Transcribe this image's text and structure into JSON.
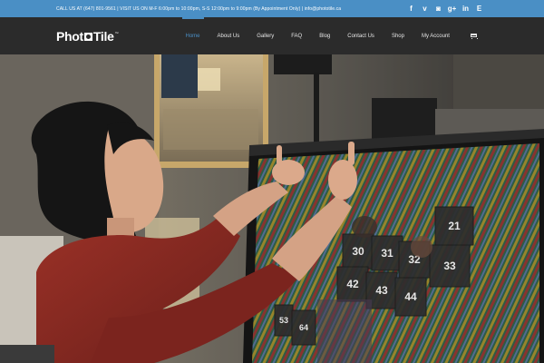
{
  "topbar": {
    "contact": "CALL US AT (647) 801-9561 | VISIT US ON M-F 6:00pm to 10:00pm, S-S 12:00pm to 9:00pm (By Appointment Only) | info@phototile.ca",
    "social_icons": [
      "facebook-icon",
      "vimeo-icon",
      "instagram-icon",
      "google-plus-icon",
      "linkedin-icon",
      "email-icon"
    ],
    "social_glyphs": [
      "f",
      "v",
      "◙",
      "g+",
      "in",
      "E"
    ]
  },
  "nav": {
    "logo_text": "Photo Tile",
    "logo_tm": "™",
    "items": [
      "Home",
      "About Us",
      "Gallery",
      "FAQ",
      "Blog",
      "Contact Us",
      "Shop",
      "My Account"
    ],
    "active": "Home",
    "cart_icon": "cart-icon"
  },
  "hero": {
    "tile_numbers": [
      "21",
      "30",
      "31",
      "32",
      "33",
      "42",
      "43",
      "44",
      "53",
      "64"
    ]
  },
  "colors": {
    "accent": "#4a8fc5",
    "nav_bg": "#2b2b2b",
    "shirt": "#8a2a24"
  }
}
